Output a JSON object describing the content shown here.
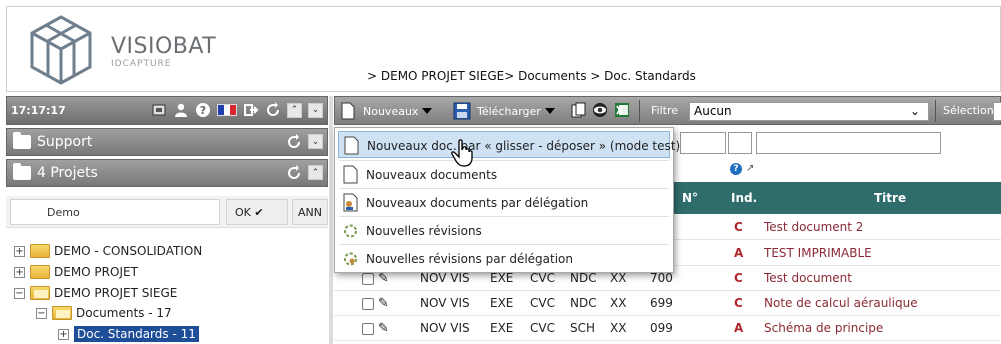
{
  "header": {
    "brand_name": "VISIOBAT",
    "brand_sub": "IDCAPTURE",
    "breadcrumb": "> DEMO PROJET SIEGE> Documents > Doc. Standards"
  },
  "left_panel": {
    "clock": "17:17:17",
    "support_label": "Support",
    "projects_label": "4 Projets",
    "search_value": "Demo",
    "ok_label": "OK ✔",
    "cancel_label": "ANN",
    "tree": [
      {
        "label": "DEMO - CONSOLIDATION",
        "sign": "+"
      },
      {
        "label": "DEMO PROJET",
        "sign": "+"
      },
      {
        "label": "DEMO PROJET SIEGE",
        "sign": "−"
      },
      {
        "label": "Documents - 17",
        "sign": "−"
      },
      {
        "label": "Doc. Standards - 11",
        "sign": "+"
      }
    ]
  },
  "toolbar": {
    "nouveaux_label": "Nouveaux",
    "telecharger_label": "Télécharger",
    "filtre_label": "Filtre",
    "filtre_value": "Aucun",
    "selection_label": "Sélection"
  },
  "menu": {
    "items": [
      {
        "label": "Nouveaux doc. par « glisser - déposer » (mode test)",
        "icon": "new-document-icon"
      },
      {
        "label": "Nouveaux documents",
        "icon": "new-document-icon"
      },
      {
        "label": "Nouveaux documents par délégation",
        "icon": "delegation-document-icon"
      },
      {
        "label": "Nouvelles révisions",
        "icon": "revision-icon"
      },
      {
        "label": "Nouvelles révisions par délégation",
        "icon": "revision-delegation-icon"
      }
    ]
  },
  "grid": {
    "headers": {
      "num": "N°",
      "ind": "Ind.",
      "titre": "Titre"
    },
    "rows": [
      {
        "num": "",
        "ind": "C",
        "titre": "Test document 2"
      },
      {
        "num": "",
        "ind": "A",
        "titre": "TEST IMPRIMABLE"
      },
      {
        "emetteur": "NOV VIS",
        "phase": "EXE",
        "lot": "CVC",
        "type": "NDC",
        "niveau": "XX",
        "num": "700",
        "ind": "C",
        "titre": "Test document"
      },
      {
        "emetteur": "NOV VIS",
        "phase": "EXE",
        "lot": "CVC",
        "type": "NDC",
        "niveau": "XX",
        "num": "699",
        "ind": "C",
        "titre": "Note de calcul aéraulique"
      },
      {
        "emetteur": "NOV VIS",
        "phase": "EXE",
        "lot": "CVC",
        "type": "SCH",
        "niveau": "XX",
        "num": "099",
        "ind": "A",
        "titre": "Schéma de principe"
      }
    ]
  },
  "colors": {
    "header_bar": "#7e7e7e",
    "grid_header": "#2f6c6c",
    "selected_tree": "#1f4e99",
    "ind_red": "#b0262d",
    "menu_highlight": "#cfe2f3"
  }
}
